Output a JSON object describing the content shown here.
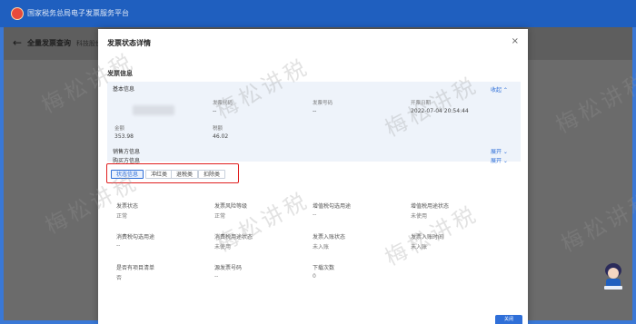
{
  "app": {
    "title": "国家税务总局电子发票服务平台"
  },
  "page": {
    "back_symbol": "←",
    "title": "全量发票查询",
    "subtitle": "科技股份有限公司"
  },
  "modal": {
    "title": "发票状态详情",
    "close_symbol": "×",
    "section_title": "发票信息",
    "basic_info": {
      "header": "基本信息",
      "collapse_label": "收起 ⌃",
      "fields": [
        {
          "label": "发票代码",
          "value": "--"
        },
        {
          "label": "发票号码",
          "value": "--"
        },
        {
          "label": "开票日期",
          "value": "2022-07-04 20:54:44"
        },
        {
          "label": "金额",
          "value": "353.98"
        },
        {
          "label": "税额",
          "value": "46.02"
        }
      ]
    },
    "seller_info": {
      "label": "销售方信息",
      "expand_label": "展开 ⌄"
    },
    "buyer_info": {
      "label": "购买方信息",
      "expand_label": "展开 ⌄"
    },
    "tabs": [
      "状态信息",
      "冲红类",
      "退税类",
      "扣除类"
    ],
    "status_fields": [
      {
        "label": "发票状态",
        "value": "正常"
      },
      {
        "label": "发票风险等级",
        "value": "正常"
      },
      {
        "label": "增值税勾选用途",
        "value": "--"
      },
      {
        "label": "增值税用途状态",
        "value": "未使用"
      },
      {
        "label": "消费税勾选用途",
        "value": "--"
      },
      {
        "label": "消费税用途状态",
        "value": "未使用"
      },
      {
        "label": "发票入账状态",
        "value": "未入账"
      },
      {
        "label": "发票入账时间",
        "value": "未入账"
      },
      {
        "label": "是否有项目清单",
        "value": "否"
      },
      {
        "label": "源发票号码",
        "value": "--"
      },
      {
        "label": "下载次数",
        "value": "0"
      }
    ],
    "confirm_label": "关闭"
  },
  "watermark": {
    "text": "梅松讲税"
  },
  "colors": {
    "brand": "#1f5fbf",
    "link": "#2f6fd8",
    "highlight": "#e02020"
  },
  "icons": {
    "close": "close-icon",
    "back": "back-arrow-icon",
    "avatar": "assistant-avatar-icon"
  }
}
